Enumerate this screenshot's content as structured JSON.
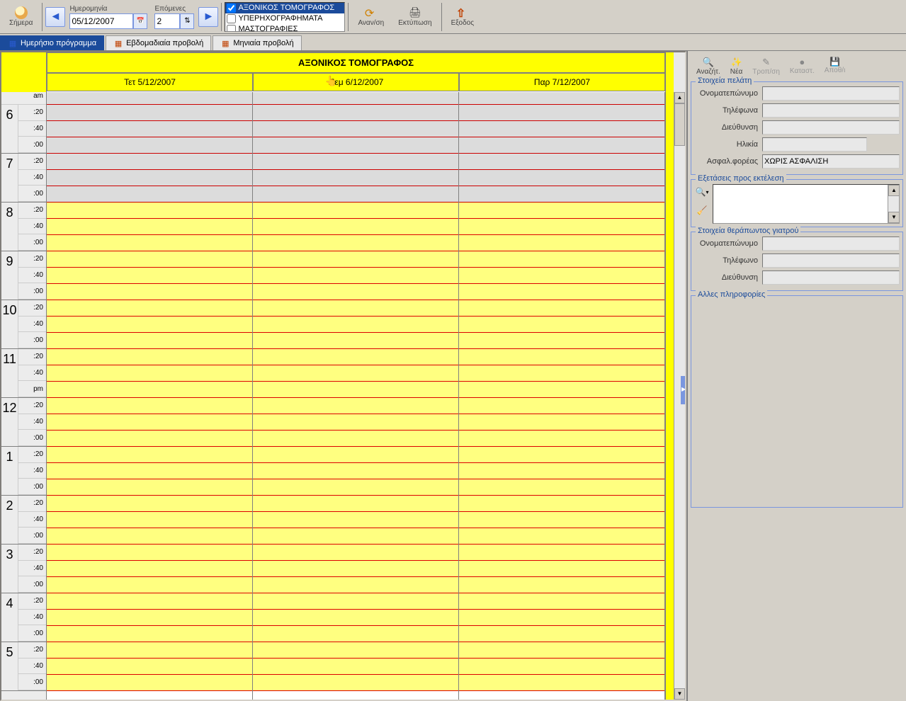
{
  "toolbar": {
    "today_label": "Σήμερα",
    "date_label": "Ημερομηνία",
    "date_value": "05/12/2007",
    "next_label": "Επόμενες",
    "next_value": "2",
    "resources": [
      {
        "label": "ΑΞΟΝΙΚΟΣ ΤΟΜΟΓΡΑΦΟΣ",
        "checked": true,
        "selected": true
      },
      {
        "label": "ΥΠΕΡΗΧΟΓΡΑΦΗΜΑΤΑ",
        "checked": false,
        "selected": false
      },
      {
        "label": "ΜΑΣΤΟΓΡΑΦΙΕΣ",
        "checked": false,
        "selected": false
      }
    ],
    "refresh_label": "Αναν/ση",
    "print_label": "Εκτύπωση",
    "exit_label": "Εξοδος"
  },
  "tabs": {
    "daily": "Ημερήσιο πρόγραμμα",
    "weekly": "Εβδομαδιαία προβολή",
    "monthly": "Μηνιαία προβολή"
  },
  "schedule": {
    "resource_title": "ΑΞΟΝΙΚΟΣ ΤΟΜΟΓΡΑΦΟΣ",
    "days": [
      "Τετ 5/12/2007",
      "Πεμ 6/12/2007",
      "Παρ 7/12/2007"
    ],
    "am_label": "am",
    "pm_label": "pm",
    "hours": [
      6,
      7,
      8,
      9,
      10,
      11,
      12,
      1,
      2,
      3,
      4,
      5
    ],
    "minutes": [
      ":20",
      ":40",
      ":00"
    ],
    "off_hours_until_row": 6
  },
  "side": {
    "buttons": {
      "search": "Αναζήτ.",
      "new": "Νέα",
      "edit": "Τροπ/ση",
      "delete": "Καταστ.",
      "save": "Αποθ/ι"
    },
    "client_section": "Στοιχεία πελάτη",
    "client_fields": {
      "name": "Ονοματεπώνυμο",
      "phones": "Τηλέφωνα",
      "address": "Διεύθυνση",
      "age": "Ηλικία",
      "insurance": "Ασφαλ.φορέας",
      "insurance_value": "ΧΩΡΙΣ ΑΣΦΑΛΙΣΗ"
    },
    "exams_section": "Εξετάσεις προς εκτέλεση",
    "doctor_section": "Στοιχεία θεράπωντος γιατρού",
    "doctor_fields": {
      "name": "Ονοματεπώνυμο",
      "phone": "Τηλέφωνο",
      "address": "Διεύθυνση"
    },
    "other_section": "Αλλες πληροφορίες"
  }
}
